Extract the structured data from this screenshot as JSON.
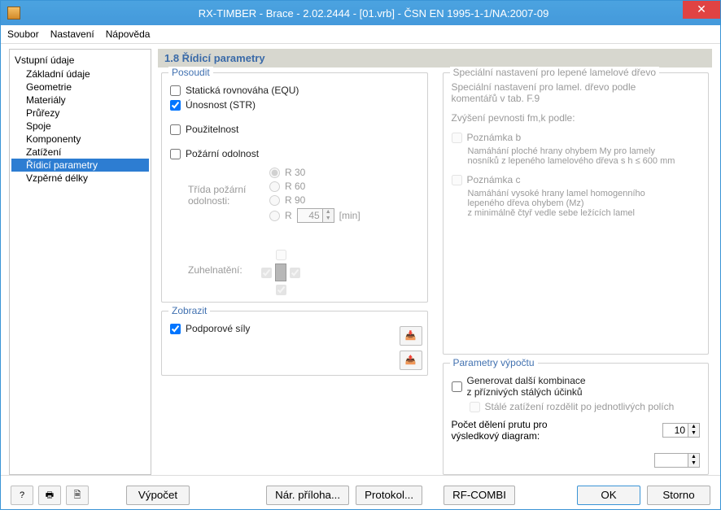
{
  "window": {
    "title": "RX-TIMBER - Brace - 2.02.2444 - [01.vrb] - ČSN EN 1995-1-1/NA:2007-09"
  },
  "menu": {
    "file": "Soubor",
    "settings": "Nastavení",
    "help": "Nápověda"
  },
  "tree": {
    "root": "Vstupní údaje",
    "items": [
      "Základní údaje",
      "Geometrie",
      "Materiály",
      "Průřezy",
      "Spoje",
      "Komponenty",
      "Zatížení",
      "Řídicí parametry",
      "Vzpěrné délky"
    ],
    "selected_index": 7
  },
  "main": {
    "title": "1.8 Řídicí parametry"
  },
  "assess": {
    "legend": "Posoudit",
    "equ": "Statická rovnováha (EQU)",
    "str": "Únosnost (STR)",
    "serviceability": "Použitelnost",
    "fire": "Požární odolnost",
    "fire_class_label": "Třída požární odolnosti:",
    "r30": "R 30",
    "r60": "R 60",
    "r90": "R 90",
    "rcustom": "R",
    "rcustom_value": "45",
    "rcustom_unit": "[min]",
    "charring": "Zuhelnatění:"
  },
  "display": {
    "legend": "Zobrazit",
    "support": "Podporové síly"
  },
  "glulam": {
    "legend": "Speciální nastavení pro lepené lamelové dřevo",
    "intro1": "Speciální nastavení pro lamel. dřevo podle",
    "intro2": "komentářů v tab. F.9",
    "strength_label": "Zvýšení pevnosti fm,k podle:",
    "noteb": "Poznámka b",
    "noteb1": "Namáhání ploché hrany ohybem My pro lamely",
    "noteb2": "nosníků z lepeného lamelového dřeva s h ≤ 600 mm",
    "notec": "Poznámka c",
    "notec1": "Namáhání vysoké hrany lamel homogenního",
    "notec2": "lepeného dřeva ohybem (Mz)",
    "notec3": "z minimálně čtyř vedle sebe ležících lamel"
  },
  "calcparams": {
    "legend": "Parametry výpočtu",
    "gen1": "Generovat další kombinace",
    "gen2": "z příznivých stálých účinků",
    "split": "Stálé zatížení rozdělit po jednotlivých polích",
    "divisions1": "Počet dělení prutu pro",
    "divisions2": "výsledkový diagram:",
    "divisions_value": "10"
  },
  "footer": {
    "calc": "Výpočet",
    "annex": "Nár. příloha...",
    "protocol": "Protokol...",
    "rfcombi": "RF-COMBI",
    "ok": "OK",
    "cancel": "Storno"
  }
}
